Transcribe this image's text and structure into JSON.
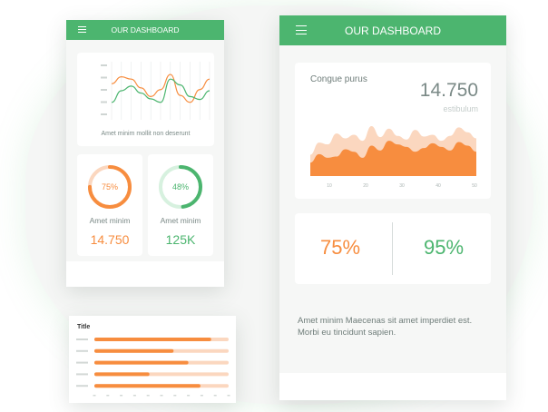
{
  "colors": {
    "green": "#4cb56f",
    "orange": "#f78d3f",
    "peach": "#fbd7bf",
    "light_green": "#d7f1df",
    "text": "#7b8a87"
  },
  "small_phone": {
    "app_title": "OUR DASHBOARD",
    "menu_icon": "hamburger-icon",
    "chart_caption": "Amet minim mollit non deserunt",
    "stat_left": {
      "percent": "75%",
      "fraction": 0.75,
      "label": "Amet minim",
      "value": "14.750"
    },
    "stat_right": {
      "percent": "48%",
      "fraction": 0.48,
      "label": "Amet minim",
      "value": "125K"
    }
  },
  "large_phone": {
    "app_title": "OUR DASHBOARD",
    "menu_icon": "hamburger-icon",
    "area_card": {
      "label": "Congue purus",
      "value": "14.750",
      "sublabel": "estibulum"
    },
    "stats": {
      "left": "75%",
      "right": "95%"
    },
    "paragraph": "Amet minim Maecenas sit amet imperdiet est. Morbi eu tincidunt sapien."
  },
  "bar_card": {
    "title": "Title"
  },
  "chart_data": [
    {
      "type": "line",
      "x": [
        0,
        1,
        2,
        3,
        4,
        5,
        6,
        7,
        8,
        9,
        10
      ],
      "series": [
        {
          "values": [
            62,
            74,
            70,
            55,
            40,
            52,
            78,
            42,
            30,
            52,
            70
          ]
        },
        {
          "values": [
            30,
            50,
            58,
            46,
            36,
            30,
            70,
            60,
            40,
            35,
            50
          ]
        }
      ]
    },
    {
      "type": "area",
      "x": [
        10,
        20,
        30,
        40,
        50
      ],
      "x_tick_labels": [
        "10",
        "20",
        "30",
        "40",
        "50"
      ],
      "series": [
        {
          "values": [
            35,
            55,
            52,
            70,
            62,
            68,
            58,
            82,
            64,
            78,
            66,
            60,
            76,
            65,
            68,
            58,
            66,
            80,
            72,
            62
          ]
        },
        {
          "values": [
            22,
            36,
            30,
            32,
            44,
            40,
            30,
            50,
            42,
            58,
            52,
            48,
            40,
            46,
            54,
            48,
            42,
            56,
            50,
            40
          ]
        }
      ]
    },
    {
      "type": "bar",
      "orientation": "horizontal",
      "categories": [
        "",
        "",
        "",
        "",
        ""
      ],
      "values": [
        0.87,
        0.59,
        0.7,
        0.41,
        0.79
      ],
      "xlim": [
        0,
        1
      ]
    }
  ]
}
